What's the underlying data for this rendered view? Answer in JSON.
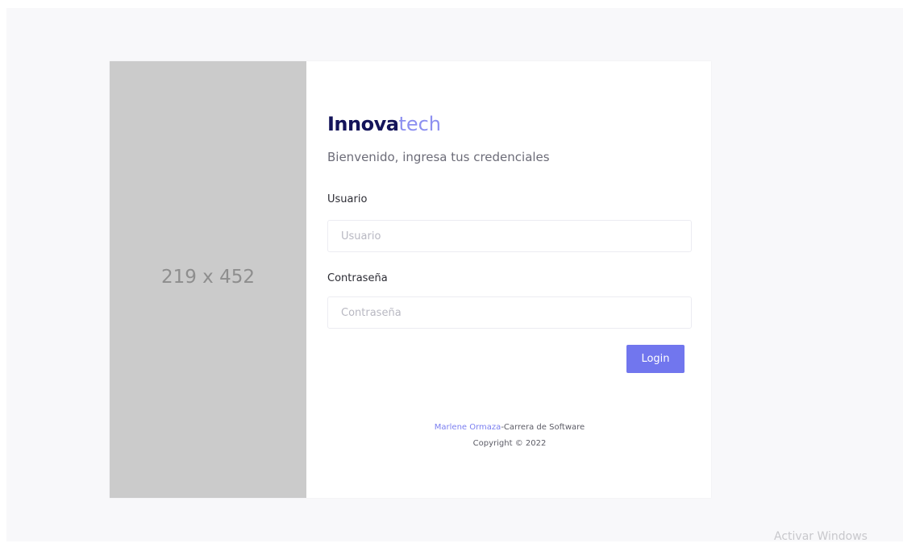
{
  "image_placeholder": {
    "text": "219 x 452"
  },
  "brand": {
    "strong": "Innova",
    "light": "tech",
    "strong_color": "#14145a",
    "light_color": "#8c8ff0"
  },
  "subtitle": "Bienvenido, ingresa tus credenciales",
  "form": {
    "username_label": "Usuario",
    "username_placeholder": "Usuario",
    "username_value": "",
    "password_label": "Contraseña",
    "password_placeholder": "Contraseña",
    "password_value": "",
    "login_label": "Login",
    "login_color": "#7176ee"
  },
  "footer": {
    "author_link": "Marlene Ormaza",
    "separator": "-",
    "program": "Carrera de Software",
    "copyright": "Copyright © 2022"
  },
  "os_watermark": "Activar Windows"
}
